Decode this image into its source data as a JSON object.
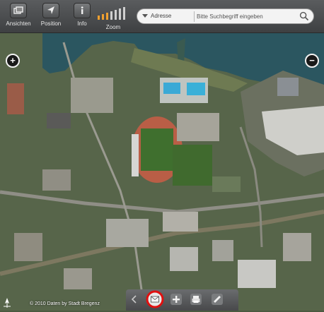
{
  "toolbar": {
    "ansichten_label": "Ansichten",
    "position_label": "Position",
    "info_label": "Info",
    "zoom_label": "Zoom",
    "zoom_level_filled": 3,
    "zoom_level_total": 7
  },
  "search": {
    "address_label": "Adresse",
    "placeholder": "Bitte Suchbegriff eingeben"
  },
  "map": {
    "zoom_in": "+",
    "zoom_out": "−",
    "copyright": "© 2010 Daten by Stadt Bregenz"
  },
  "bottom_bar": {
    "buttons": [
      "back",
      "email",
      "add",
      "print",
      "measure"
    ],
    "highlighted": "email",
    "highlight_color": "#e01010"
  },
  "colors": {
    "water": "#2a5560",
    "track": "#b85a44",
    "field": "#3e6e2e",
    "toolbar": "#4a4c4e"
  }
}
